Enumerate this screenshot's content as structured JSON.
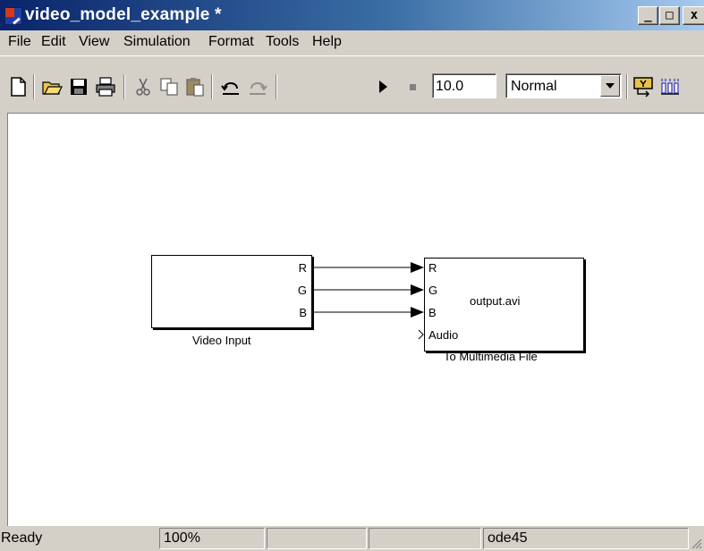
{
  "window": {
    "title": "video_model_example *",
    "controls": {
      "minimize": "_",
      "maximize": "□",
      "close": "x"
    }
  },
  "menu": [
    "File",
    "Edit",
    "View",
    "Simulation",
    "Format",
    "Tools",
    "Help"
  ],
  "toolbar": {
    "icons": [
      "new-document-icon",
      "open-folder-icon",
      "save-icon",
      "print-icon",
      "cut-icon",
      "copy-icon",
      "paste-icon",
      "undo-icon",
      "redo-icon",
      "run-icon",
      "stop-icon",
      "model-browser-icon",
      "library-browser-icon"
    ],
    "stop_time": "10.0",
    "sim_mode": "Normal"
  },
  "diagram": {
    "source_block": {
      "name": "Video Input",
      "ports": [
        "R",
        "G",
        "B"
      ]
    },
    "sink_block": {
      "name": "To Multimedia File",
      "filename": "output.avi",
      "ports": [
        "R",
        "G",
        "B",
        "Audio"
      ]
    }
  },
  "status": {
    "state": "Ready",
    "zoom": "100%",
    "pane3": "",
    "pane4": "",
    "solver": "ode45"
  }
}
